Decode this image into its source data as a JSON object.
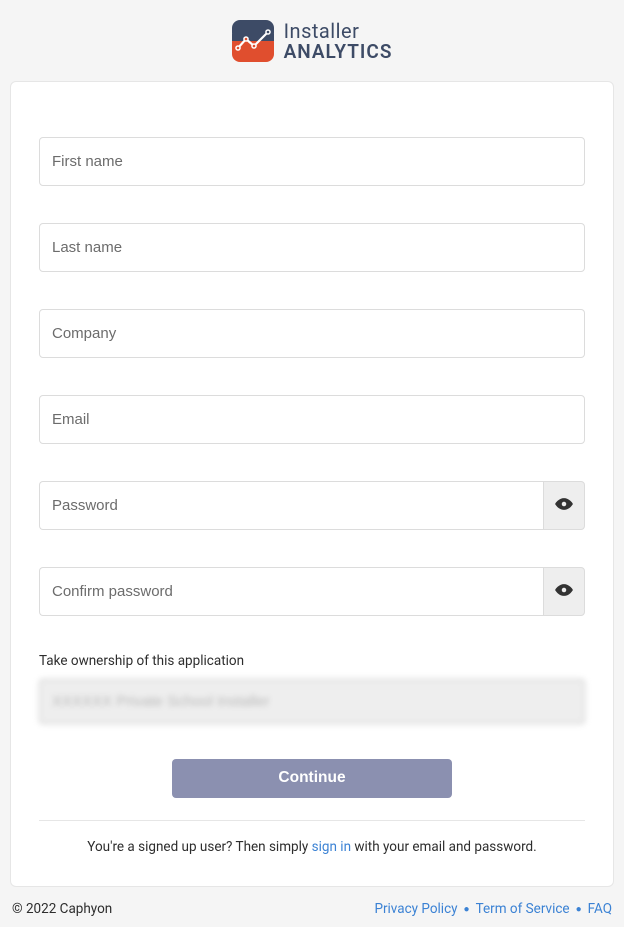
{
  "logo": {
    "top": "Installer",
    "bottom": "ANALYTICS"
  },
  "form": {
    "first_name": {
      "placeholder": "First name",
      "value": ""
    },
    "last_name": {
      "placeholder": "Last name",
      "value": ""
    },
    "company": {
      "placeholder": "Company",
      "value": ""
    },
    "email": {
      "placeholder": "Email",
      "value": ""
    },
    "password": {
      "placeholder": "Password",
      "value": ""
    },
    "confirm_password": {
      "placeholder": "Confirm password",
      "value": ""
    },
    "ownership": {
      "label": "Take ownership of this application",
      "value": "XXXXXX Private School Installer"
    },
    "continue": "Continue"
  },
  "signin": {
    "prefix": "You're a signed up user? Then simply ",
    "link": "sign in",
    "suffix": " with your email and password."
  },
  "footer": {
    "copyright": "© 2022 Caphyon",
    "links": {
      "privacy": "Privacy Policy",
      "terms": "Term of Service",
      "faq": "FAQ"
    }
  }
}
